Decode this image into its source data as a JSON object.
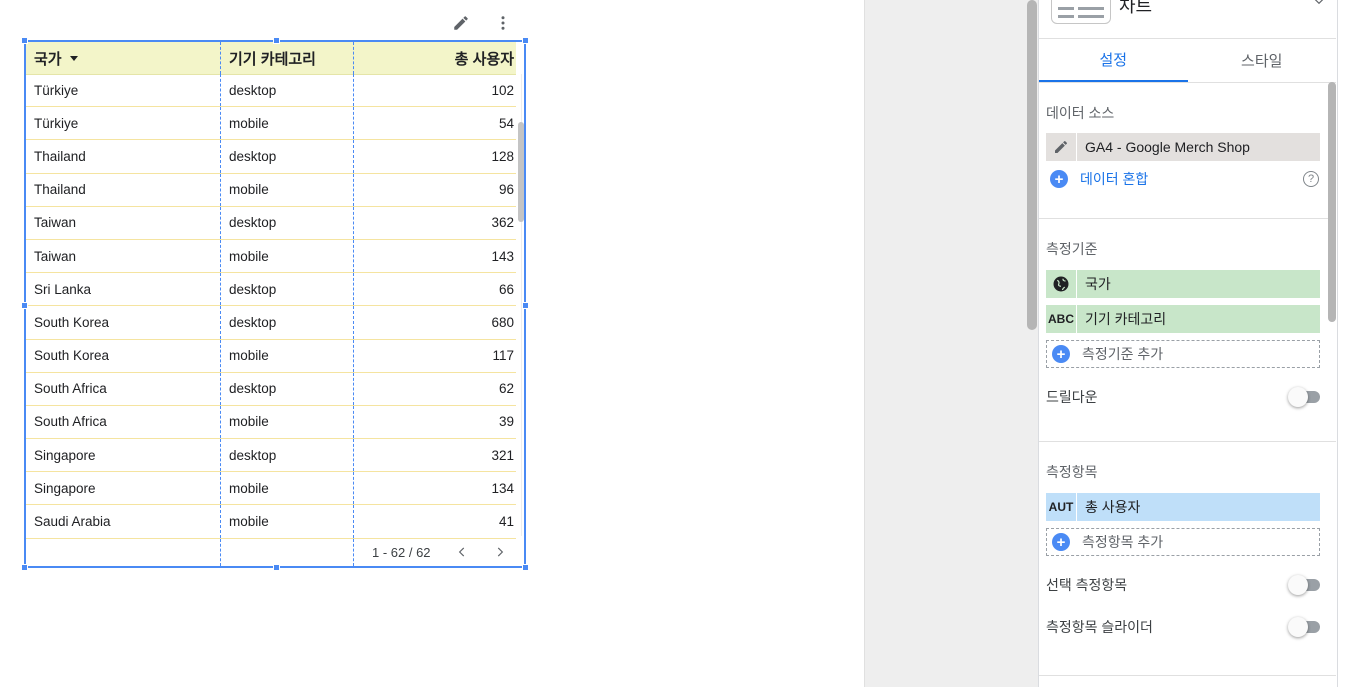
{
  "table": {
    "headers": [
      "국가",
      "기기 카테고리",
      "총 사용자"
    ],
    "rows": [
      [
        "Türkiye",
        "desktop",
        "102"
      ],
      [
        "Türkiye",
        "mobile",
        "54"
      ],
      [
        "Thailand",
        "desktop",
        "128"
      ],
      [
        "Thailand",
        "mobile",
        "96"
      ],
      [
        "Taiwan",
        "desktop",
        "362"
      ],
      [
        "Taiwan",
        "mobile",
        "143"
      ],
      [
        "Sri Lanka",
        "desktop",
        "66"
      ],
      [
        "South Korea",
        "desktop",
        "680"
      ],
      [
        "South Korea",
        "mobile",
        "117"
      ],
      [
        "South Africa",
        "desktop",
        "62"
      ],
      [
        "South Africa",
        "mobile",
        "39"
      ],
      [
        "Singapore",
        "desktop",
        "321"
      ],
      [
        "Singapore",
        "mobile",
        "134"
      ],
      [
        "Saudi Arabia",
        "mobile",
        "41"
      ]
    ],
    "pagination": "1 - 62 / 62"
  },
  "icons": {
    "edit": "pencil-icon",
    "more": "more-vert-icon",
    "prev": "chevron-left-icon",
    "next": "chevron-right-icon",
    "globe": "globe-icon",
    "text_type": "ABC",
    "metric_type": "AUT"
  },
  "panel": {
    "chart_name": "차트",
    "tabs": [
      "설정",
      "스타일"
    ],
    "data_source": {
      "title": "데이터 소스",
      "source": "GA4 - Google Merch Shop",
      "blend": "데이터 혼합"
    },
    "dimensions": {
      "title": "측정기준",
      "items": [
        "국가",
        "기기 카테고리"
      ],
      "add": "측정기준 추가"
    },
    "drilldown": "드릴다운",
    "metrics": {
      "title": "측정항목",
      "items": [
        "총 사용자"
      ],
      "add": "측정항목 추가"
    },
    "optional_metrics": "선택 측정항목",
    "metric_slider": "측정항목 슬라이더"
  },
  "colors": {
    "accent": "#1a73e8",
    "header_bg": "#f3f5c9",
    "dimension_chip": "#c8e6c9",
    "metric_chip": "#bfdff9",
    "selection": "#4a8af4"
  }
}
